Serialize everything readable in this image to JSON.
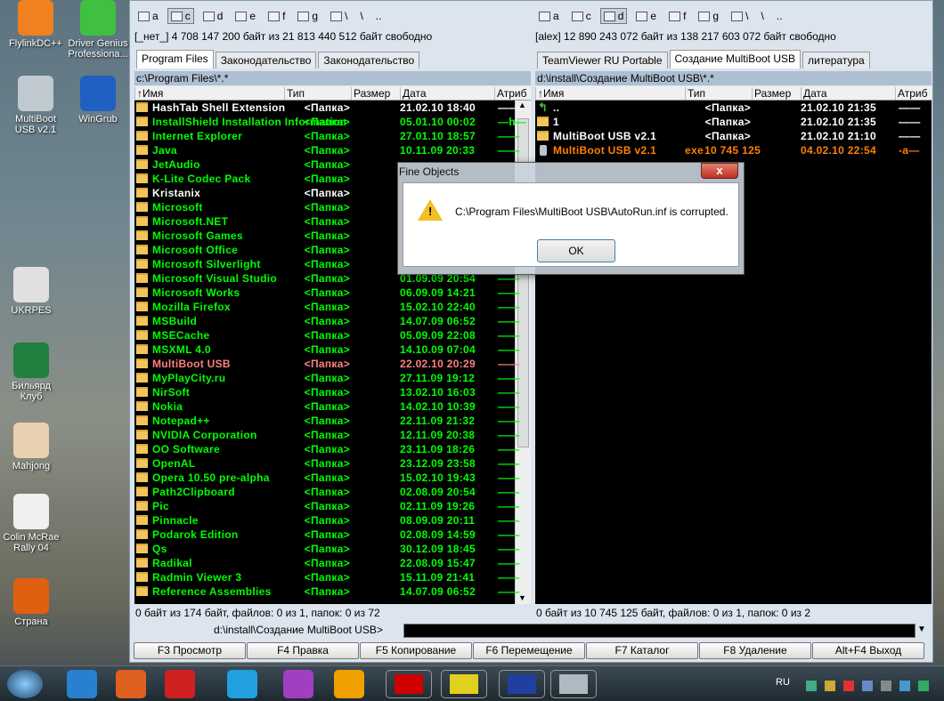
{
  "desktop": [
    {
      "label": "FlylinkDC++",
      "color": "#f08020"
    },
    {
      "label": "Driver Genius Professiona...",
      "color": "#40c040"
    },
    {
      "label": "MultiBoot USB v2.1",
      "color": "#c0c8d0"
    },
    {
      "label": "WinGrub",
      "color": "#2060c0"
    },
    {
      "label": "UKRPES",
      "color": "#e0e0e0"
    },
    {
      "label": "Бильярд Клуб",
      "color": "#208040"
    },
    {
      "label": "Mahjong",
      "color": "#e8d0b0"
    },
    {
      "label": "Colin McRae Rally 04",
      "color": "#f0f0f0"
    },
    {
      "label": "Страна",
      "color": "#e06010"
    }
  ],
  "left": {
    "drives": [
      "a",
      "c",
      "d",
      "e",
      "f",
      "g",
      "\\",
      "\\",
      ".."
    ],
    "selected": 1,
    "free": "[_нет_]  4 708 147 200 байт из 21 813 440 512 байт свободно",
    "tabs": [
      "Program Files",
      "Законодательство",
      "Законодательство"
    ],
    "active_tab": 0,
    "path": "c:\\Program Files\\*.*",
    "rows": [
      [
        "HashTab Shell Extension",
        "",
        "<Папка>",
        "21.02.10 18:40",
        "——",
        "#ffffff"
      ],
      [
        "InstallShield Installation Information",
        "",
        "<Папка>",
        "05.01.10 00:02",
        "—h—",
        "#00ff00"
      ],
      [
        "Internet Explorer",
        "",
        "<Папка>",
        "27.01.10 18:57",
        "——",
        "#00ff00"
      ],
      [
        "Java",
        "",
        "<Папка>",
        "10.11.09 20:33",
        "——",
        "#00ff00"
      ],
      [
        "JetAudio",
        "",
        "<Папка>",
        "",
        "",
        "#00ff00"
      ],
      [
        "K-Lite Codec Pack",
        "",
        "<Папка>",
        "",
        "",
        "#00ff00"
      ],
      [
        "Kristanix",
        "",
        "<Папка>",
        "",
        "",
        "#ffffff"
      ],
      [
        "Microsoft",
        "",
        "<Папка>",
        "",
        "",
        "#00ff00"
      ],
      [
        "Microsoft.NET",
        "",
        "<Папка>",
        "",
        "",
        "#00ff00"
      ],
      [
        "Microsoft Games",
        "",
        "<Папка>",
        "",
        "",
        "#00ff00"
      ],
      [
        "Microsoft Office",
        "",
        "<Папка>",
        "",
        "",
        "#00ff00"
      ],
      [
        "Microsoft Silverlight",
        "",
        "<Папка>",
        "",
        "",
        "#00ff00"
      ],
      [
        "Microsoft Visual Studio",
        "",
        "<Папка>",
        "01.09.09 20:54",
        "——",
        "#00ff00"
      ],
      [
        "Microsoft Works",
        "",
        "<Папка>",
        "06.09.09 14:21",
        "——",
        "#00ff00"
      ],
      [
        "Mozilla Firefox",
        "",
        "<Папка>",
        "15.02.10 22:40",
        "——",
        "#00ff00"
      ],
      [
        "MSBuild",
        "",
        "<Папка>",
        "14.07.09 06:52",
        "——",
        "#00ff00"
      ],
      [
        "MSECache",
        "",
        "<Папка>",
        "05.09.09 22:08",
        "——",
        "#00ff00"
      ],
      [
        "MSXML 4.0",
        "",
        "<Папка>",
        "14.10.09 07:04",
        "——",
        "#00ff00"
      ],
      [
        "MultiBoot USB",
        "",
        "<Папка>",
        "22.02.10 20:29",
        "——",
        "#ff8080"
      ],
      [
        "MyPlayCity.ru",
        "",
        "<Папка>",
        "27.11.09 19:12",
        "——",
        "#00ff00"
      ],
      [
        "NirSoft",
        "",
        "<Папка>",
        "13.02.10 16:03",
        "——",
        "#00ff00"
      ],
      [
        "Nokia",
        "",
        "<Папка>",
        "14.02.10 10:39",
        "——",
        "#00ff00"
      ],
      [
        "Notepad++",
        "",
        "<Папка>",
        "22.11.09 21:32",
        "——",
        "#00ff00"
      ],
      [
        "NVIDIA Corporation",
        "",
        "<Папка>",
        "12.11.09 20:38",
        "——",
        "#00ff00"
      ],
      [
        "OO Software",
        "",
        "<Папка>",
        "23.11.09 18:26",
        "——",
        "#00ff00"
      ],
      [
        "OpenAL",
        "",
        "<Папка>",
        "23.12.09 23:58",
        "——",
        "#00ff00"
      ],
      [
        "Opera 10.50 pre-alpha",
        "",
        "<Папка>",
        "15.02.10 19:43",
        "——",
        "#00ff00"
      ],
      [
        "Path2Clipboard",
        "",
        "<Папка>",
        "02.08.09 20:54",
        "——",
        "#00ff00"
      ],
      [
        "Pic",
        "",
        "<Папка>",
        "02.11.09 19:26",
        "——",
        "#00ff00"
      ],
      [
        "Pinnacle",
        "",
        "<Папка>",
        "08.09.09 20:11",
        "——",
        "#00ff00"
      ],
      [
        "Podarok Edition",
        "",
        "<Папка>",
        "02.08.09 14:59",
        "——",
        "#00ff00"
      ],
      [
        "Qs",
        "",
        "<Папка>",
        "30.12.09 18:45",
        "——",
        "#00ff00"
      ],
      [
        "Radikal",
        "",
        "<Папка>",
        "22.08.09 15:47",
        "——",
        "#00ff00"
      ],
      [
        "Radmin Viewer 3",
        "",
        "<Папка>",
        "15.11.09 21:41",
        "——",
        "#00ff00"
      ],
      [
        "Reference Assemblies",
        "",
        "<Папка>",
        "14.07.09 06:52",
        "——",
        "#00ff00"
      ]
    ],
    "status": "0 байт из 174 байт, файлов: 0 из 1, папок: 0 из 72"
  },
  "right": {
    "drives": [
      "a",
      "c",
      "d",
      "e",
      "f",
      "g",
      "\\",
      "\\",
      ".."
    ],
    "selected": 2,
    "free": "[alex]  12 890 243 072 байт из 138 217 603 072 байт свободно",
    "tabs": [
      "TeamViewer RU Portable",
      "Создание MultiBoot USB",
      "литература"
    ],
    "active_tab": 1,
    "path": "d:\\install\\Создание MultiBoot USB\\*.*",
    "rows": [
      [
        "..",
        "",
        "<Папка>",
        "21.02.10 21:35",
        "——",
        "#ffffff"
      ],
      [
        "1",
        "",
        "<Папка>",
        "21.02.10 21:35",
        "——",
        "#ffffff"
      ],
      [
        "MultiBoot USB v2.1",
        "",
        "<Папка>",
        "21.02.10 21:10",
        "——",
        "#ffffff"
      ],
      [
        "MultiBoot USB v2.1",
        "exe",
        "10 745 125",
        "04.02.10 22:54",
        "-a—",
        "#ff8000"
      ]
    ],
    "status": "0 байт из 10 745 125 байт, файлов: 0 из 1, папок: 0 из 2"
  },
  "columns": [
    "↑Имя",
    "Тип",
    "Размер",
    "Дата",
    "Атриб"
  ],
  "cmd_prompt": "d:\\install\\Создание MultiBoot USB>",
  "fkeys": [
    "F3 Просмотр",
    "F4 Правка",
    "F5 Копирование",
    "F6 Перемещение",
    "F7 Каталог",
    "F8 Удаление",
    "Alt+F4 Выход"
  ],
  "dialog": {
    "title": "Fine Objects",
    "message": "C:\\Program Files\\MultiBoot USB\\AutoRun.inf is corrupted.",
    "ok": "OK",
    "close": "x"
  },
  "taskbar": {
    "apps": [
      {
        "name": "internet-explorer",
        "color": "#2a80d0"
      },
      {
        "name": "firefox",
        "color": "#e06020"
      },
      {
        "name": "flashget",
        "color": "#d02020"
      },
      {
        "name": "skype",
        "color": "#20a0e0"
      },
      {
        "name": "app-colorful",
        "color": "#a040c0"
      },
      {
        "name": "app-orange",
        "color": "#f0a000"
      },
      {
        "name": "opera",
        "color": "#d00000"
      },
      {
        "name": "the-bat",
        "color": "#e0d020"
      },
      {
        "name": "floppy",
        "color": "#2040a0"
      },
      {
        "name": "usb",
        "color": "#b0b8c0"
      }
    ],
    "lang": "RU"
  }
}
